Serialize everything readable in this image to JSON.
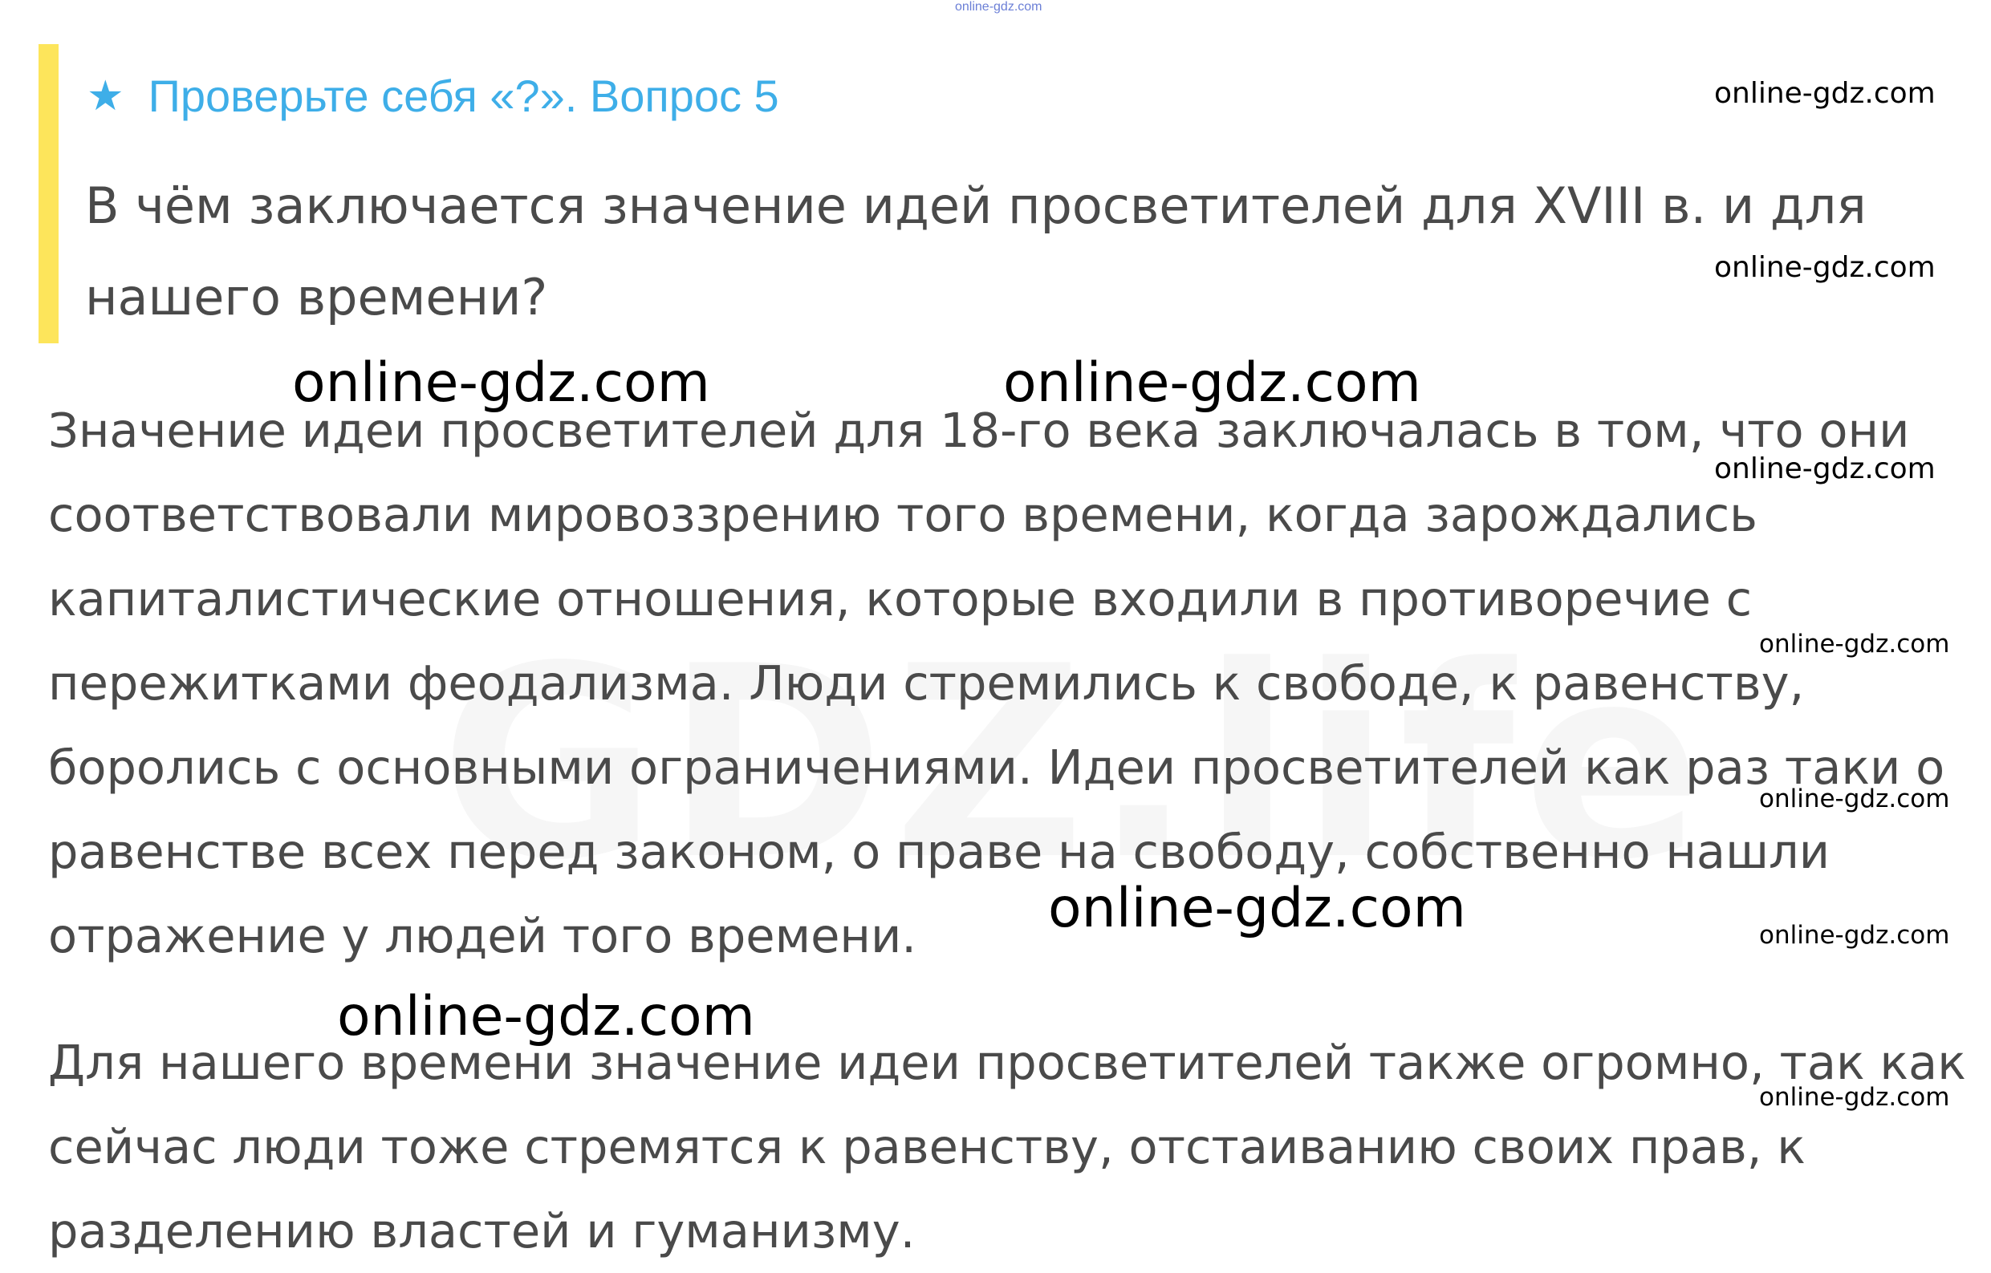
{
  "top_mark": "online-gdz.com",
  "background_logo": "GDZ.life",
  "question": {
    "icon": "star-icon",
    "header": "Проверьте себя «?». Вопрос 5",
    "text": "В чём заключается значение идей просветителей для XVIII в. и для нашего времени?"
  },
  "answer": {
    "paragraph_1": "Значение идеи просветителей для 18-го века заключалась в том, что они соответствовали мировоззрению того времени, когда зарождались капиталистические отношения, которые входили в противоречие с пережитками феодализма. Люди стремились к свободе, к равенству, боролись с основными ограничениями. Идеи просветителей как раз таки о равенстве всех перед законом, о праве на свободу, собственно нашли отражение у людей того времени.",
    "paragraph_2": "Для нашего времени значение идеи просветителей также огромно, так как сейчас люди тоже стремятся к равенству, отстаиванию своих прав, к разделению властей и гуманизму."
  },
  "watermarks": [
    "online-gdz.com",
    "online-gdz.com",
    "online-gdz.com",
    "online-gdz.com",
    "online-gdz.com",
    "online-gdz.com",
    "online-gdz.com",
    "online-gdz.com",
    "online-gdz.com",
    "online-gdz.com",
    "online-gdz.com"
  ],
  "colors": {
    "accent_bar": "#fde55b",
    "header": "#3eaee8",
    "text": "#4a4a4a"
  }
}
